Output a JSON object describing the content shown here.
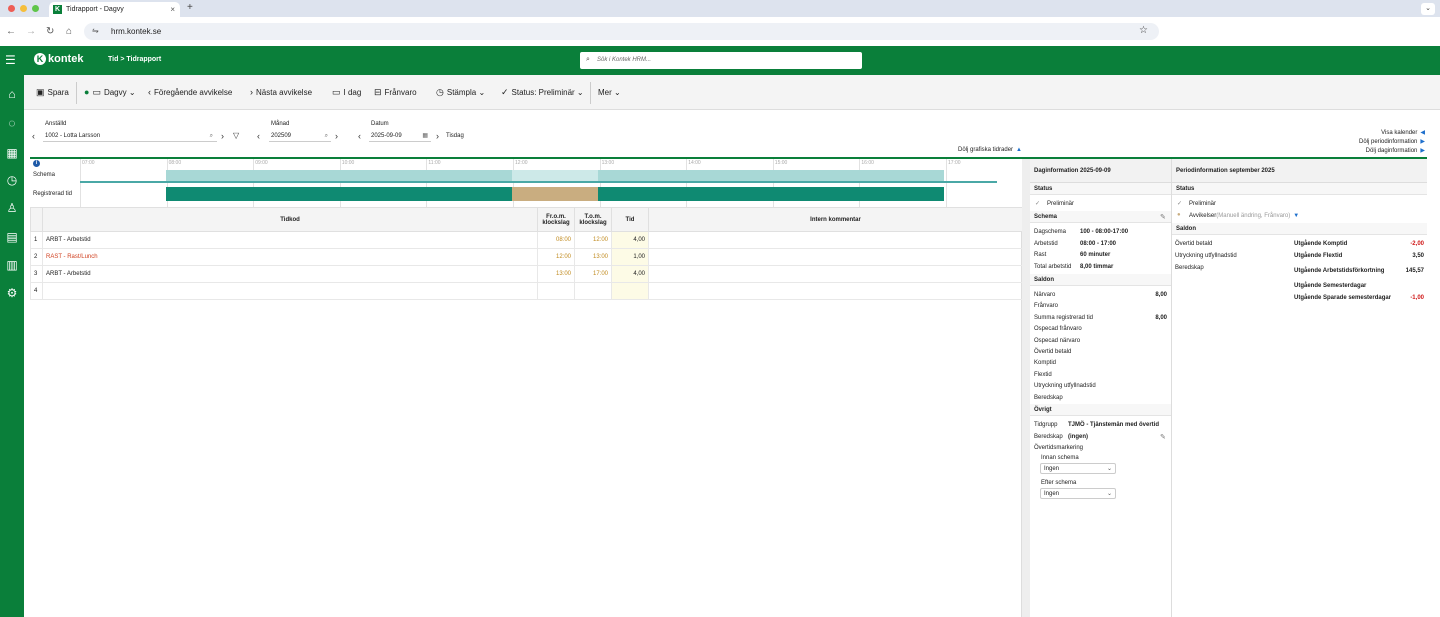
{
  "browser": {
    "tab_title": "Tidrapport - Dagvy",
    "tab_favicon": "K",
    "url": "hrm.kontek.se"
  },
  "app": {
    "logo_text": "kontek",
    "logo_mark": "K",
    "breadcrumb": "Tid > Tidrapport",
    "search_placeholder": "Sök i Kontek HRM...",
    "brand_color": "#0a7f3a"
  },
  "toolbar": {
    "save": "Spara",
    "view": "Dagvy",
    "prev": "Föregående avvikelse",
    "next": "Nästa avvikelse",
    "today": "I dag",
    "absence": "Frånvaro",
    "stamp": "Stämpla",
    "status": "Status: Preliminär",
    "more": "Mer"
  },
  "filters": {
    "employee_label": "Anställd",
    "employee_value": "1002 - Lotta Larsson",
    "month_label": "Månad",
    "month_value": "202509",
    "date_label": "Datum",
    "date_value": "2025-09-09",
    "weekday": "Tisdag",
    "show_calendar": "Visa kalender",
    "hide_period": "Dölj periodinformation",
    "hide_day": "Dölj daginformation",
    "hide_graphic": "Dölj grafiska tidrader"
  },
  "timeline": {
    "schema_label": "Schema",
    "registered_label": "Registrerad tid",
    "hours": [
      "07:00",
      "08:00",
      "09:00",
      "10:00",
      "11:00",
      "12:00",
      "13:00",
      "14:00",
      "15:00",
      "16:00",
      "17:00"
    ]
  },
  "grid": {
    "headers": {
      "tidkod": "Tidkod",
      "from": "Fr.o.m. klockslag",
      "to": "T.o.m. klockslag",
      "tid": "Tid",
      "comment": "Intern kommentar"
    },
    "rows": [
      {
        "nr": "1",
        "tidkod": "ARBT - Arbetstid",
        "from": "08:00",
        "to": "12:00",
        "tid": "4,00",
        "comment": ""
      },
      {
        "nr": "2",
        "tidkod": "RAST - Rast/Lunch",
        "from": "12:00",
        "to": "13:00",
        "tid": "1,00",
        "comment": ""
      },
      {
        "nr": "3",
        "tidkod": "ARBT - Arbetstid",
        "from": "13:00",
        "to": "17:00",
        "tid": "4,00",
        "comment": ""
      },
      {
        "nr": "4",
        "tidkod": "",
        "from": "",
        "to": "",
        "tid": "",
        "comment": ""
      }
    ]
  },
  "day": {
    "title": "Daginformation 2025-09-09",
    "status_h": "Status",
    "status_v": "Preliminär",
    "schema_h": "Schema",
    "dagschema_k": "Dagschema",
    "dagschema_v": "100 - 08:00-17:00",
    "arbetstid_k": "Arbetstid",
    "arbetstid_v": "08:00 - 17:00",
    "rast_k": "Rast",
    "rast_v": "60 minuter",
    "total_k": "Total arbetstid",
    "total_v": "8,00 timmar",
    "saldon_h": "Saldon",
    "saldon": [
      {
        "k": "Närvaro",
        "v": "8,00"
      },
      {
        "k": "Frånvaro",
        "v": ""
      },
      {
        "k": "Summa registrerad tid",
        "v": "8,00"
      },
      {
        "k": "Ospecad frånvaro",
        "v": ""
      },
      {
        "k": "Ospecad närvaro",
        "v": ""
      },
      {
        "k": "Övertid betald",
        "v": ""
      },
      {
        "k": "Komptid",
        "v": ""
      },
      {
        "k": "Flextid",
        "v": ""
      },
      {
        "k": "Utryckning utfyllnadstid",
        "v": ""
      },
      {
        "k": "Beredskap",
        "v": ""
      }
    ],
    "ovrigt_h": "Övrigt",
    "tidgrupp_k": "Tidgrupp",
    "tidgrupp_v": "TJMÖ - Tjänstemän med övertid",
    "beredskap_k": "Beredskap",
    "beredskap_v": "(ingen)",
    "overtid_mark": "Övertidsmarkering",
    "innan_schema": "Innan schema",
    "innan_value": "Ingen",
    "efter_schema": "Efter schema",
    "efter_value": "Ingen"
  },
  "period": {
    "title": "Periodinformation september 2025",
    "status_h": "Status",
    "status_v": "Preliminär",
    "avvikelser_k": "Avvikelser",
    "avvikelser_v": "(Manuell ändring, Frånvaro)",
    "saldon_h": "Saldon",
    "left": [
      {
        "k": "Övertid betald"
      },
      {
        "k": "Utryckning utfyllnadstid"
      },
      {
        "k": "Beredskap"
      }
    ],
    "right": [
      {
        "k": "Utgående Komptid",
        "v": "-2,00",
        "neg": true
      },
      {
        "k": "Utgående Flextid",
        "v": "3,50",
        "neg": false
      },
      {
        "k": "Utgående Arbetstidsförkortning",
        "v": "145,57",
        "neg": false
      },
      {
        "k": "Utgående Semesterdagar",
        "v": "",
        "neg": false
      },
      {
        "k": "Utgående Sparade semesterdagar",
        "v": "-1,00",
        "neg": true
      }
    ]
  },
  "colors": {
    "schema_light": "#a8d8d6",
    "schema_lighter": "#cde9e8",
    "work_dark": "#0f8a72",
    "break_tan": "#c9ad80",
    "negative_red": "#d01818",
    "link_blue": "#1e6fcc"
  }
}
